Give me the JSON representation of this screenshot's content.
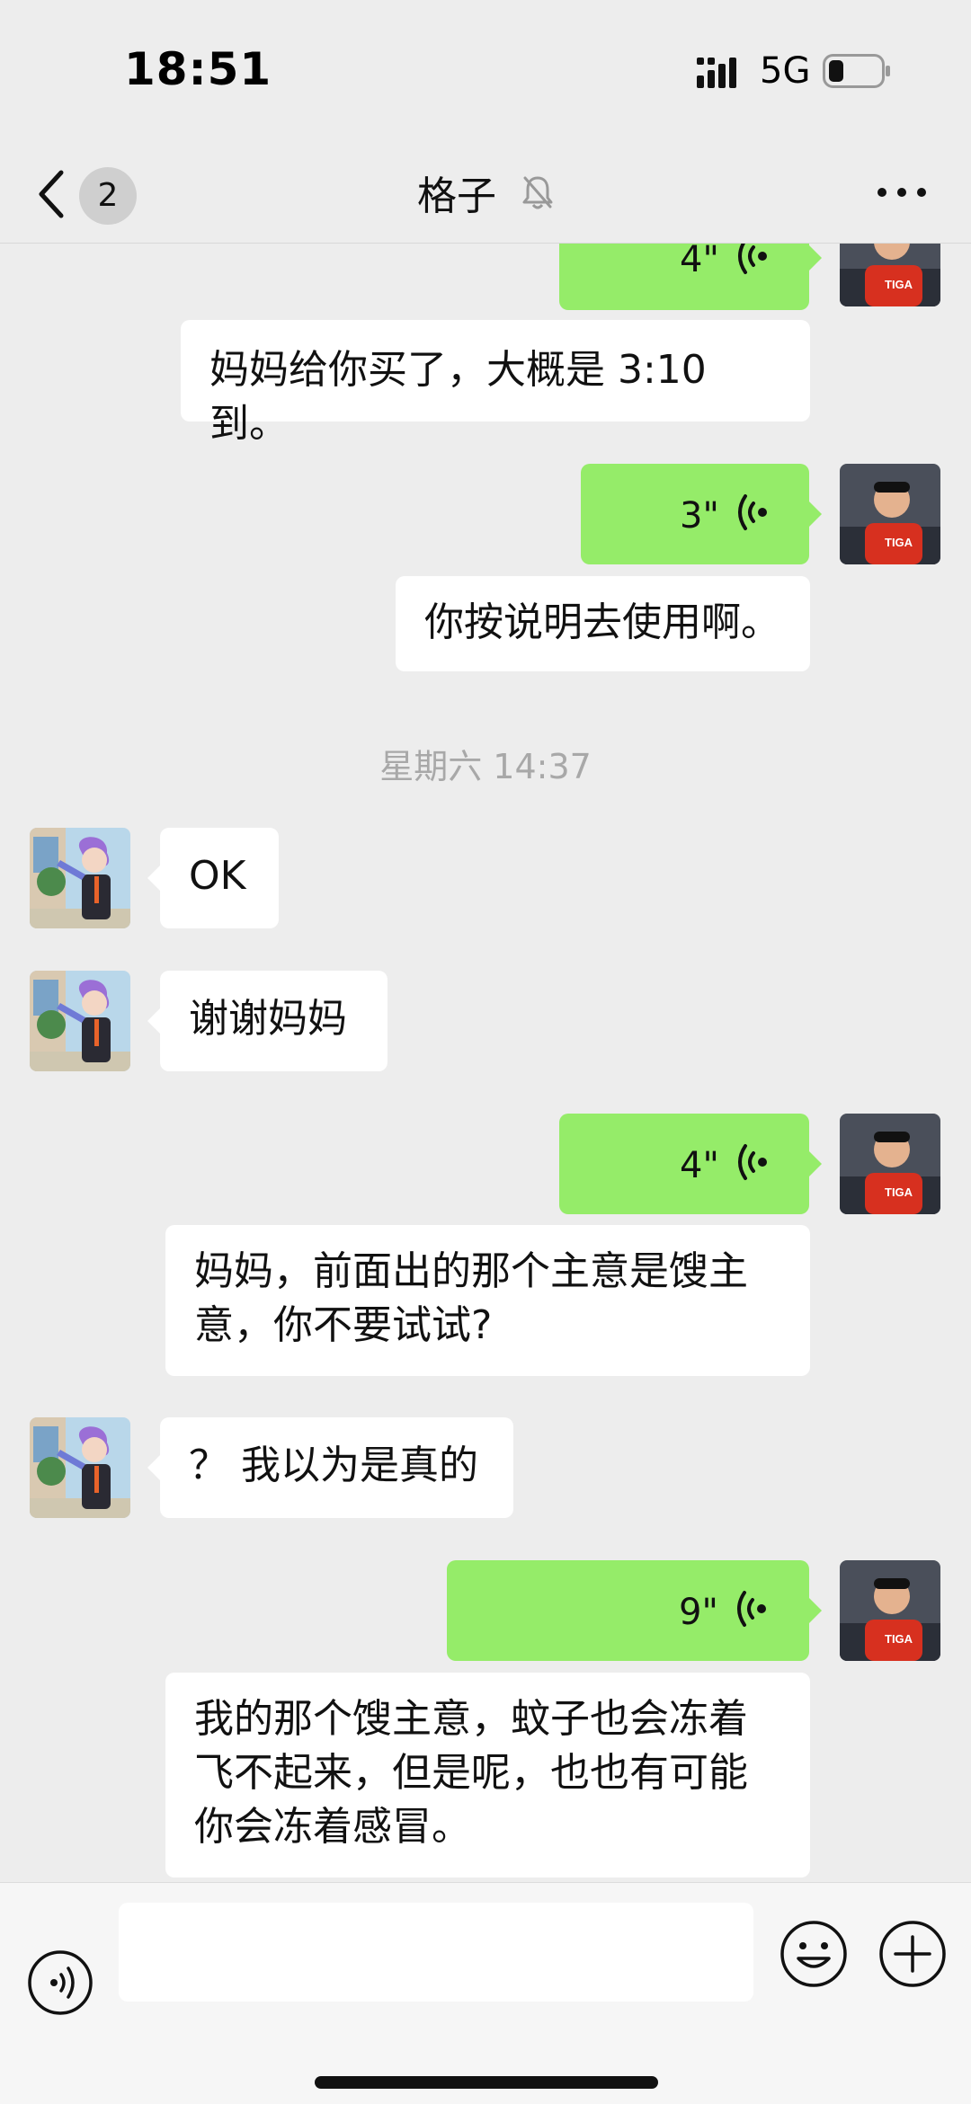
{
  "status_bar": {
    "time": "18:51",
    "network": "5G"
  },
  "nav": {
    "back_badge": "2",
    "title": "格子"
  },
  "messages": [
    {
      "type": "voice",
      "side": "right",
      "duration": "4\""
    },
    {
      "type": "text",
      "side": "right",
      "text": "妈妈给你买了，大概是 3:10 到。"
    },
    {
      "type": "voice",
      "side": "right",
      "duration": "3\""
    },
    {
      "type": "text",
      "side": "right",
      "text": "你按说明去使用啊。"
    },
    {
      "type": "time",
      "text": "星期六 14:37"
    },
    {
      "type": "text",
      "side": "left",
      "text": "OK"
    },
    {
      "type": "text",
      "side": "left",
      "text": "谢谢妈妈"
    },
    {
      "type": "voice",
      "side": "right",
      "duration": "4\""
    },
    {
      "type": "text",
      "side": "right",
      "lines": [
        "妈妈，前面出的那个主意是馊主",
        "意，你不要试试?"
      ]
    },
    {
      "type": "text",
      "side": "left",
      "text": "？ 我以为是真的"
    },
    {
      "type": "voice",
      "side": "right",
      "duration": "9\""
    },
    {
      "type": "text",
      "side": "right",
      "lines": [
        "我的那个馊主意，蚊子也会冻着",
        "飞不起来，但是呢，也也有可能",
        "你会冻着感冒。"
      ]
    }
  ],
  "colors": {
    "background": "#ededed",
    "bubble_self": "#95ec69",
    "bubble_other": "#ffffff",
    "timestamp": "#a8a8a8"
  },
  "input": {
    "value": "",
    "placeholder": ""
  },
  "icons": [
    "signal-icon",
    "battery-icon",
    "chevron-left-icon",
    "mute-bell-icon",
    "more-icon",
    "voice-wave-icon",
    "voice-input-icon",
    "emoji-icon",
    "plus-icon",
    "avatar-self",
    "avatar-contact"
  ]
}
